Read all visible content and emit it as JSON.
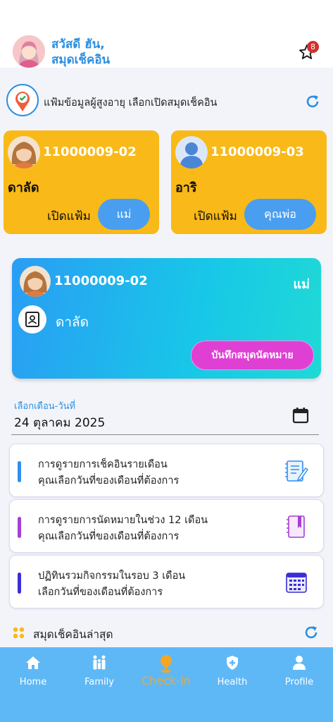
{
  "header": {
    "greeting_line1": "สวัสดี ฮัน,",
    "greeting_line2": "สมุดเช็คอิน",
    "notification_count": "8"
  },
  "section": {
    "title": "แฟ้มข้อมูลผู้สูงอายุ เลือกเปิดสมุดเช็คอิน"
  },
  "elders": [
    {
      "id": "11000009-02",
      "name": "ดาลัด",
      "open_label": "เปิดแฟ้ม",
      "relation": "แม่"
    },
    {
      "id": "11000009-03",
      "name": "อาริ",
      "open_label": "เปิดแฟ้ม",
      "relation": "คุณพ่อ"
    }
  ],
  "selected": {
    "id": "11000009-02",
    "relation": "แม่",
    "name": "ดาลัด",
    "book_button": "บันทึกสมุดนัดหมาย"
  },
  "date": {
    "label": "เลือกเดือน-วันที่",
    "value": "24 ตุลาคม 2025"
  },
  "menu": [
    {
      "line1": "การดูรายการเช็คอินรายเดือน",
      "line2": "คุณเลือกวันที่ของเดือนที่ต้องการ",
      "color": "#2f8ff0"
    },
    {
      "line1": "การดูรายการนัดหมายในช่วง 12 เดือน",
      "line2": "คุณเลือกวันที่ของเดือนที่ต้องการ",
      "color": "#a63fd6"
    },
    {
      "line1": "ปฏิทินรวมกิจกรรมในรอบ 3 เดือน",
      "line2": "เลือกวันที่ของเดือนที่ต้องการ",
      "color": "#3a2fd6"
    }
  ],
  "latest": {
    "title": "สมุดเช็คอินล่าสุด"
  },
  "nav": {
    "home": "Home",
    "family": "Family",
    "checkin": "Check-in",
    "health": "Health",
    "profile": "Profile"
  }
}
